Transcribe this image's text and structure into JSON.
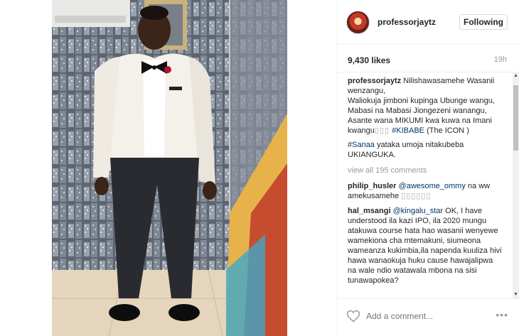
{
  "post": {
    "username": "professorjaytz",
    "follow_label": "Following",
    "likes": "9,430 likes",
    "time": "19h"
  },
  "caption": {
    "username": "professorjaytz",
    "text": "Nilishawasamehe Wasanii wenzangu,\nWaliokuja jimboni kupinga Ubunge wangu,\nMabasi na Mabasi Jiongezeni wanangu,\nAsante wana MIKUMI kwa kuwa na Imani kwangu",
    "emoji": "▯▯▯",
    "hashtag1": "#KIBABE",
    "after_hashtag": " (The ICON )",
    "hashtag2": "#Sanaa",
    "text2": " yataka umoja nitakubeba UKIANGUKA."
  },
  "view_all": "view all 195 comments",
  "comments": [
    {
      "username": "philip_husler",
      "mention": "@awesome_ommy",
      "text": " na ww amekusamehe ",
      "emoji": "▯▯▯▯▯▯"
    },
    {
      "username": "hal_msangi",
      "mention": "@kingalu_star",
      "text": " OK, I have understood ila kazi IPO, ila 2020 mungu atakuwa course hata hao wasanii wenyewe wamekiona cha mtemakuni, siumeona wameanza kukimbia,ila napenda kuuliza hivi hawa wanaokuja huku cause hawajalipwa na wale ndio watawala mbona na sisi tunawapokea?",
      "emoji": ""
    }
  ],
  "footer": {
    "comment_placeholder": "Add a comment...",
    "more_label": "•••"
  },
  "icons": {
    "heart": "heart-icon",
    "more": "more-options-icon",
    "scroll_up": "scroll-up-arrow",
    "scroll_down": "scroll-down-arrow"
  }
}
